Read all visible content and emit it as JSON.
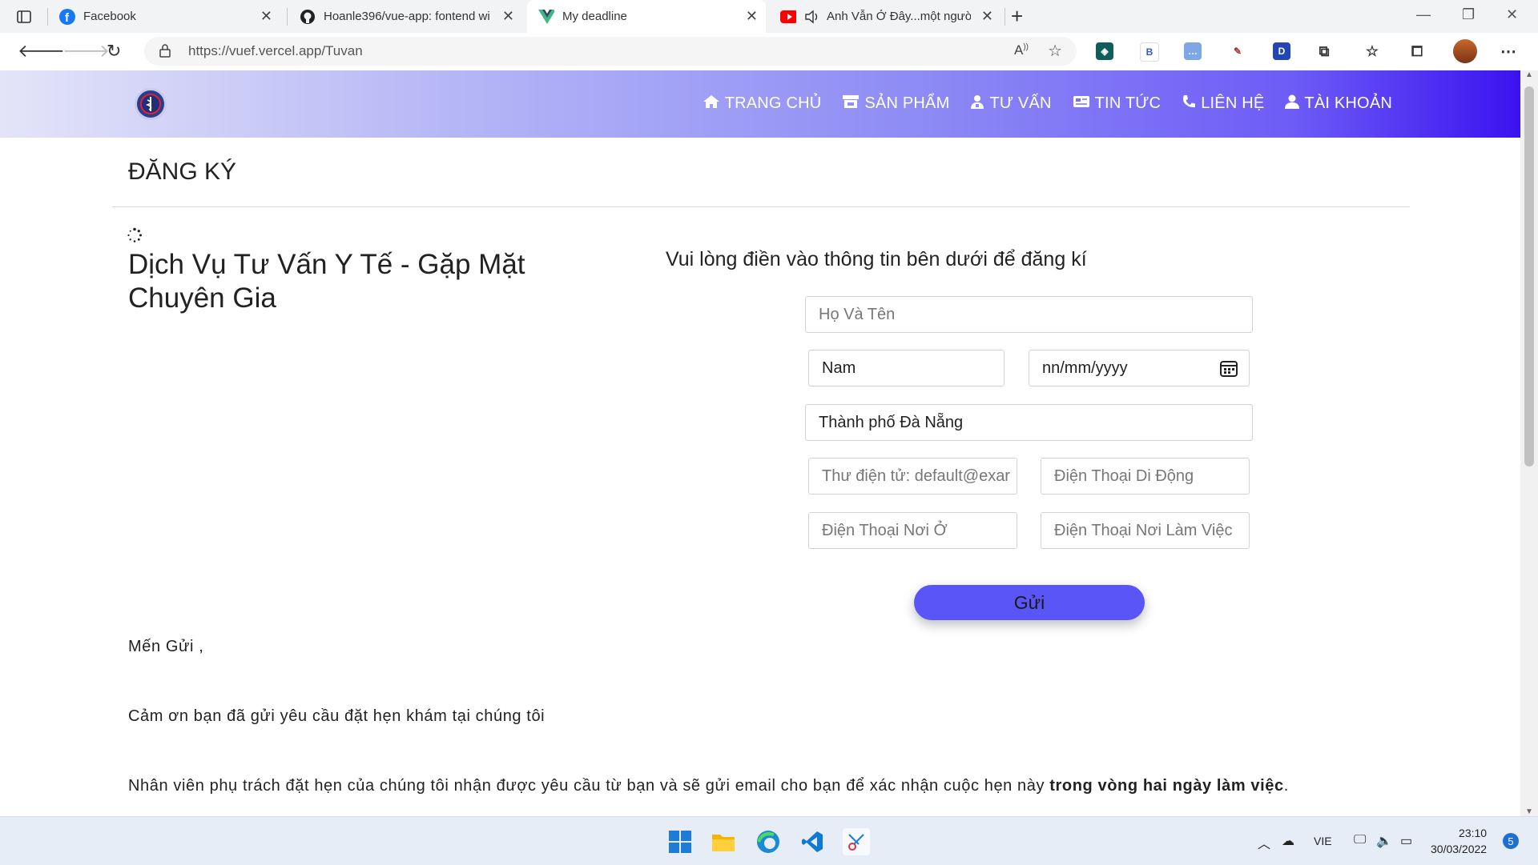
{
  "browser": {
    "tabs": [
      {
        "title": "Facebook",
        "icon": "facebook-icon"
      },
      {
        "title": "Hoanle396/vue-app: fontend wi",
        "icon": "github-icon"
      },
      {
        "title": "My deadline",
        "icon": "vue-icon",
        "active": true
      },
      {
        "title": "Anh Vẫn Ở Đây...một người",
        "icon": "youtube-icon"
      }
    ],
    "url": "https://vuef.vercel.app/Tuvan"
  },
  "header": {
    "nav": [
      {
        "label": "TRANG CHỦ",
        "icon": "home-icon"
      },
      {
        "label": "SẢN PHẨM",
        "icon": "store-icon"
      },
      {
        "label": "TƯ VẤN",
        "icon": "user-doctor-icon"
      },
      {
        "label": "TIN TỨC",
        "icon": "newspaper-icon"
      },
      {
        "label": "LIÊN HỆ",
        "icon": "phone-icon"
      },
      {
        "label": "TÀI KHOẢN",
        "icon": "user-icon"
      }
    ],
    "colors": {
      "gradient_start": "#e4e4f8",
      "gradient_end": "#3b12f0"
    }
  },
  "page": {
    "title": "ĐĂNG KÝ",
    "service_title": "Dịch Vụ Tư Vấn Y Tế - Gặp Mặt Chuyên Gia",
    "form_hint": "Vui lòng điền vào thông tin bên dưới để đăng kí",
    "form": {
      "full_name_placeholder": "Họ Và Tên",
      "gender_value": "Nam",
      "dob_placeholder": "nn/mm/yyyy",
      "city_value": "Thành phố Đà Nẵng",
      "email_placeholder": "Thư điện tử: default@exar",
      "mobile_placeholder": "Điện Thoại Di Động",
      "home_phone_placeholder": "Điện Thoại Nơi Ở",
      "work_phone_placeholder": "Điện Thoại Nơi Làm Việc",
      "submit_label": "Gửi",
      "submit_color": "#5a55f7"
    },
    "letter": {
      "greeting": "Mến Gửi ,",
      "thanks": "Cảm ơn bạn đã gửi yêu cầu đặt hẹn khám tại chúng tôi",
      "notice_prefix": "Nhân viên phụ trách đặt hẹn của chúng tôi nhận được yêu cầu từ bạn và sẽ gửi email cho bạn để xác nhận cuộc hẹn này ",
      "notice_bold": "trong vòng hai ngày làm việc",
      "notice_suffix": "."
    }
  },
  "taskbar": {
    "language": "VIE",
    "time": "23:10",
    "date": "30/03/2022",
    "notification_count": "5"
  }
}
